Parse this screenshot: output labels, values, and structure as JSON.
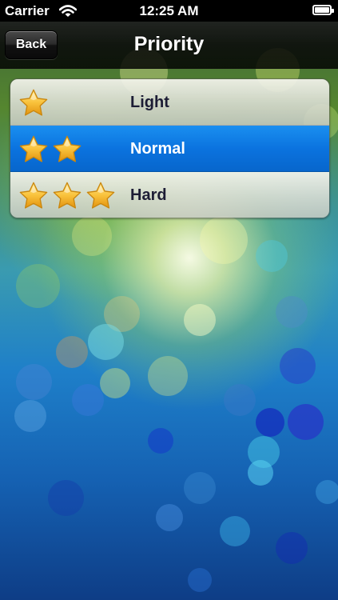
{
  "status_bar": {
    "carrier": "Carrier",
    "time": "12:25 AM",
    "wifi_icon": "wifi-icon",
    "battery_icon": "battery-icon"
  },
  "nav_bar": {
    "back_label": "Back",
    "title": "Priority"
  },
  "priority_list": {
    "selected_index": 1,
    "items": [
      {
        "label": "Light",
        "stars": 1,
        "icon": "star-icon",
        "selected": false
      },
      {
        "label": "Normal",
        "stars": 2,
        "icon": "star-icon",
        "selected": true
      },
      {
        "label": "Hard",
        "stars": 3,
        "icon": "star-icon",
        "selected": false
      }
    ]
  },
  "colors": {
    "selection_blue": "#0b73df",
    "star_gold": "#f5b51f",
    "row_text": "#1d1d35",
    "nav_bar": "#111111"
  }
}
